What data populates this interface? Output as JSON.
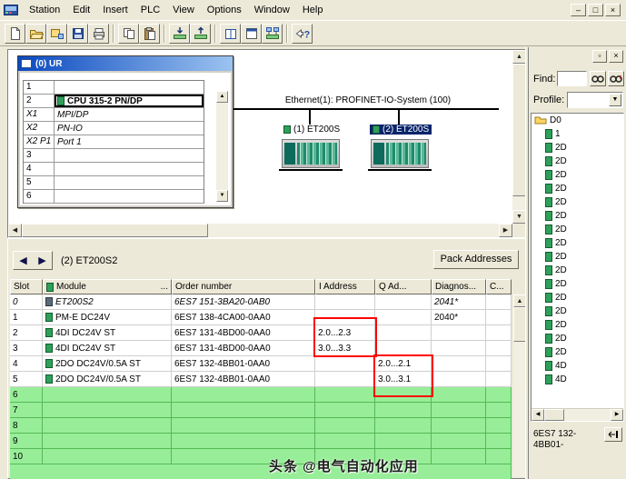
{
  "colors": {
    "chrome": "#ECE9D8",
    "rack_title_gradient_start": "#0a49c0",
    "rack_title_gradient_end": "#9cc3f0",
    "selection_blue": "#0a246a",
    "empty_row_green": "#98EE98",
    "highlight_red": "#ff0000"
  },
  "menu": {
    "items": [
      "Station",
      "Edit",
      "Insert",
      "PLC",
      "View",
      "Options",
      "Window",
      "Help"
    ],
    "window_controls": [
      {
        "name": "minimize",
        "glyph": "–"
      },
      {
        "name": "restore",
        "glyph": "□"
      },
      {
        "name": "close",
        "glyph": "×"
      }
    ]
  },
  "toolbar": {
    "items": [
      "new",
      "open",
      "open-online",
      "save-compile",
      "print",
      "|",
      "copy",
      "paste",
      "|",
      "download",
      "upload",
      "|",
      "catalog",
      "arrange-windows",
      "network",
      "|",
      "help"
    ]
  },
  "station": {
    "rack": {
      "title": "(0) UR",
      "rows": [
        {
          "slot": "1",
          "label": ""
        },
        {
          "slot": "2",
          "label": "CPU 315-2 PN/DP",
          "bold": true,
          "icon": true,
          "selected": true
        },
        {
          "slot": "X1",
          "label": "MPI/DP",
          "italic": true
        },
        {
          "slot": "X2",
          "label": "PN-IO",
          "italic": true
        },
        {
          "slot": "X2 P1",
          "label": "Port 1",
          "italic": true
        },
        {
          "slot": "3",
          "label": ""
        },
        {
          "slot": "4",
          "label": ""
        },
        {
          "slot": "5",
          "label": ""
        },
        {
          "slot": "6",
          "label": ""
        }
      ]
    },
    "bus_label": "Ethernet(1): PROFINET-IO-System (100)",
    "devices": [
      {
        "label": "(1) ET200S",
        "selected": false
      },
      {
        "label": "(2) ET200S",
        "selected": true
      }
    ]
  },
  "detail": {
    "title": "(2)  ET200S2",
    "pack_button": "Pack Addresses",
    "columns": [
      "Slot",
      "Module",
      "Order number",
      "I Address",
      "Q Ad...",
      "Diagnos...",
      "C..."
    ],
    "columns_overflow": "...",
    "rows": [
      {
        "slot": "0",
        "module": "ET200S2",
        "order": "6ES7 151-3BA20-0AB0",
        "i": "",
        "q": "",
        "diag": "2041*",
        "c": "",
        "italic": true,
        "icon": "rack"
      },
      {
        "slot": "1",
        "module": "PM-E DC24V",
        "order": "6ES7 138-4CA00-0AA0",
        "i": "",
        "q": "",
        "diag": "2040*",
        "c": "",
        "icon": "module"
      },
      {
        "slot": "2",
        "module": "4DI DC24V ST",
        "order": "6ES7 131-4BD00-0AA0",
        "i": "2.0...2.3",
        "q": "",
        "diag": "",
        "c": "",
        "icon": "module"
      },
      {
        "slot": "3",
        "module": "4DI DC24V ST",
        "order": "6ES7 131-4BD00-0AA0",
        "i": "3.0...3.3",
        "q": "",
        "diag": "",
        "c": "",
        "icon": "module"
      },
      {
        "slot": "4",
        "module": "2DO DC24V/0.5A ST",
        "order": "6ES7 132-4BB01-0AA0",
        "i": "",
        "q": "2.0...2.1",
        "diag": "",
        "c": "",
        "icon": "module"
      },
      {
        "slot": "5",
        "module": "2DO DC24V/0.5A ST",
        "order": "6ES7 132-4BB01-0AA0",
        "i": "",
        "q": "3.0...3.1",
        "diag": "",
        "c": "",
        "icon": "module"
      },
      {
        "slot": "6",
        "module": "",
        "order": "",
        "i": "",
        "q": "",
        "diag": "",
        "c": "",
        "green": true
      },
      {
        "slot": "7",
        "module": "",
        "order": "",
        "i": "",
        "q": "",
        "diag": "",
        "c": "",
        "green": true
      },
      {
        "slot": "8",
        "module": "",
        "order": "",
        "i": "",
        "q": "",
        "diag": "",
        "c": "",
        "green": true
      },
      {
        "slot": "9",
        "module": "",
        "order": "",
        "i": "",
        "q": "",
        "diag": "",
        "c": "",
        "green": true
      },
      {
        "slot": "10",
        "module": "",
        "order": "",
        "i": "",
        "q": "",
        "diag": "",
        "c": "",
        "green": true
      }
    ]
  },
  "catalog": {
    "find_label": "Find:",
    "find_value": "",
    "profile_label": "Profile:",
    "profile_value": "",
    "tree": {
      "root": "D0",
      "items": [
        "1",
        "2D",
        "2D",
        "2D",
        "2D",
        "2D",
        "2D",
        "2D",
        "2D",
        "2D",
        "2D",
        "2D",
        "2D",
        "2D",
        "2D",
        "2D",
        "2D",
        "4D",
        "4D"
      ]
    },
    "footer_text": "6ES7 132-4BB01-"
  },
  "watermark": "头条 @电气自动化应用"
}
